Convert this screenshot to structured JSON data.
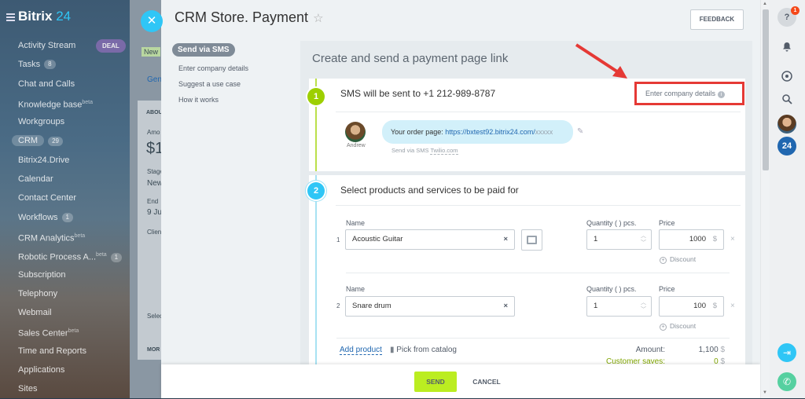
{
  "sidebar": {
    "brand_name": "Bitrix",
    "brand_num": "24",
    "deal_tag": "DEAL",
    "items": [
      {
        "label": "Activity Stream"
      },
      {
        "label": "Tasks",
        "count": "8"
      },
      {
        "label": "Chat and Calls"
      },
      {
        "label": "Knowledge base",
        "sup": "beta"
      },
      {
        "label": "Workgroups"
      },
      {
        "label": "CRM",
        "count": "29"
      },
      {
        "label": "Bitrix24.Drive"
      },
      {
        "label": "Calendar"
      },
      {
        "label": "Contact Center"
      },
      {
        "label": "Workflows",
        "count": "1"
      },
      {
        "label": "CRM Analytics",
        "sup": "beta"
      },
      {
        "label": "Robotic Process A...",
        "sup": "beta",
        "count": "1"
      },
      {
        "label": "Subscription"
      },
      {
        "label": "Telephony"
      },
      {
        "label": "Webmail"
      },
      {
        "label": "Sales Center",
        "sup": "beta"
      },
      {
        "label": "Time and Reports"
      },
      {
        "label": "Applications"
      },
      {
        "label": "Sites"
      }
    ]
  },
  "background_page": {
    "new_label": "New",
    "gen_tab": "Gen",
    "about": "ABOU",
    "amount": "Amo",
    "dollar": "$1",
    "stage": "Stage",
    "new_stage": "New",
    "end": "End",
    "date": "9 Ju",
    "client": "Clien",
    "select": "Selec",
    "more": "MOR"
  },
  "panel": {
    "title": "CRM Store. Payment",
    "feedback_label": "FEEDBACK",
    "nav": {
      "active": "Send via SMS",
      "items": [
        "Enter company details",
        "Suggest a use case",
        "How it works"
      ]
    },
    "content_title": "Create and send a payment page link"
  },
  "step1": {
    "num": "1",
    "title": "SMS will be sent to +1 212-989-8787",
    "company_link": "Enter company details",
    "sender_name": "Andrew",
    "message_prefix": "Your order page: ",
    "message_url": "https://bxtest92.bitrix24.com/",
    "message_url_tail": "xxxxx",
    "sms_via_prefix": "Send via SMS ",
    "sms_via_provider": "Twilio.com"
  },
  "step2": {
    "num": "2",
    "title": "Select products and services to be paid for",
    "name_label": "Name",
    "qty_label": "Quantity ( ) pcs.",
    "price_label": "Price",
    "discount_label": "Discount",
    "currency": "$",
    "rows": [
      {
        "num": "1",
        "name": "Acoustic Guitar",
        "qty": "1",
        "price": "1000"
      },
      {
        "num": "2",
        "name": "Snare drum",
        "qty": "1",
        "price": "100"
      }
    ],
    "add_product": "Add product",
    "pick_catalog": "Pick from catalog",
    "amount_label": "Amount:",
    "amount_value": "1,100",
    "saves_label": "Customer saves:",
    "saves_value": "0"
  },
  "footer": {
    "send_label": "SEND",
    "cancel_label": "CANCEL"
  },
  "rightbar": {
    "help_badge": "1",
    "bitrix_label": "24"
  },
  "colors": {
    "accent_blue": "#2fc6f6",
    "send_green": "#bbed21",
    "highlight_red": "#e53935"
  }
}
